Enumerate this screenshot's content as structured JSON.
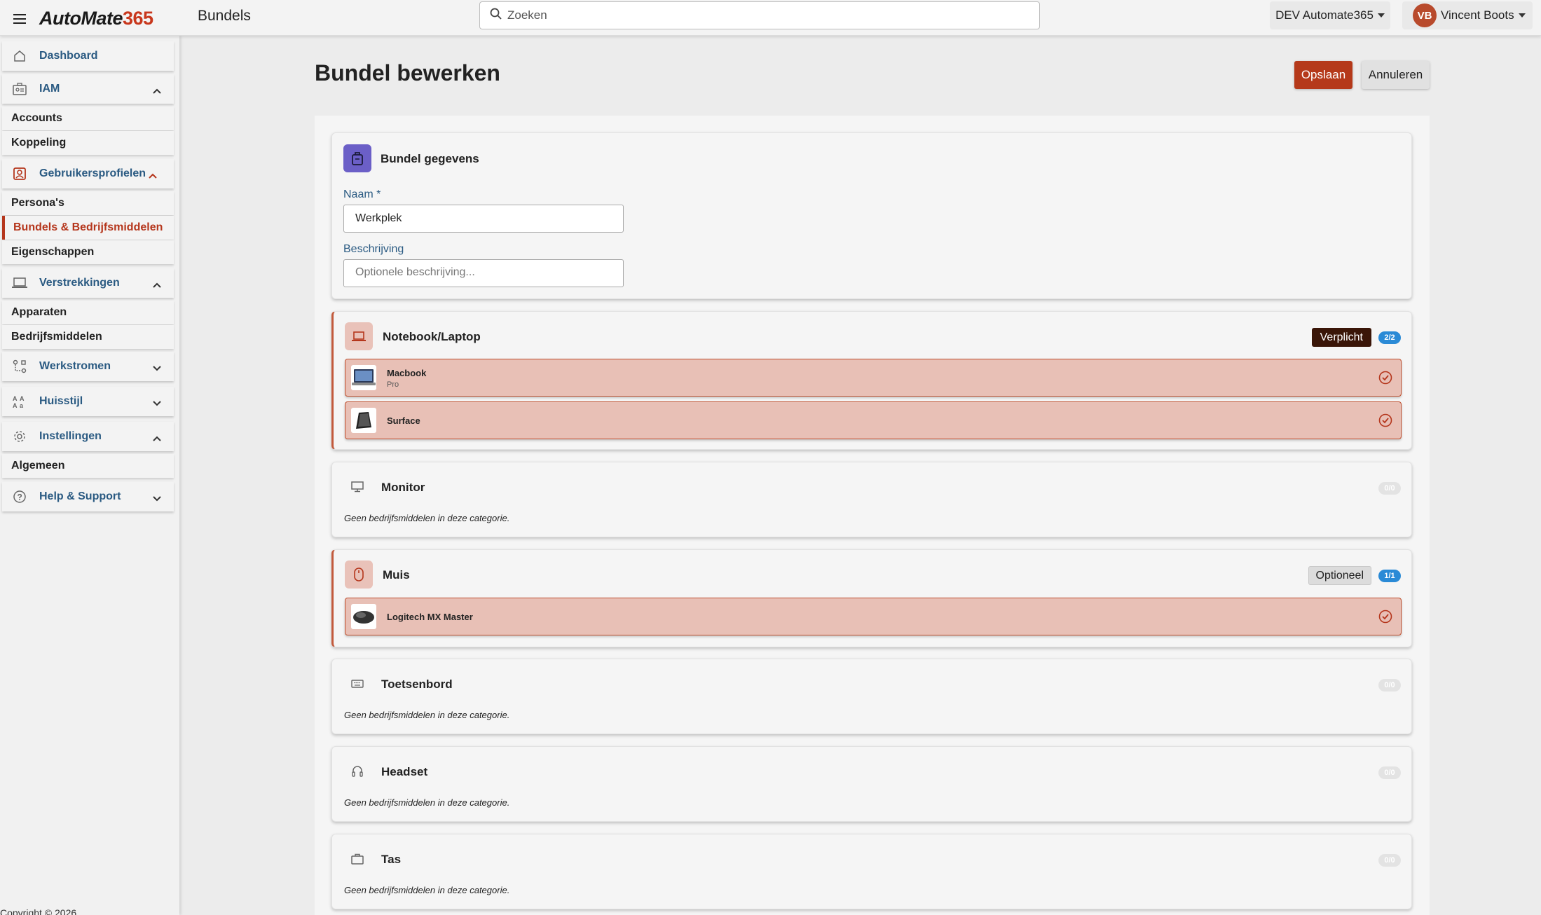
{
  "app": {
    "logo_part1": "AutoMate",
    "logo_part2": "365",
    "page_name": "Bundels"
  },
  "search": {
    "placeholder": "Zoeken"
  },
  "tenant": {
    "label": "DEV Automate365"
  },
  "user": {
    "initials": "VB",
    "name": "Vincent Boots"
  },
  "sidebar": {
    "dashboard": "Dashboard",
    "iam": {
      "label": "IAM",
      "items": [
        "Accounts",
        "Koppeling"
      ]
    },
    "profiles": {
      "label": "Gebruikersprofielen",
      "items": [
        "Persona's",
        "Bundels & Bedrijfsmiddelen",
        "Eigenschappen"
      ]
    },
    "provisioning": {
      "label": "Verstrekkingen",
      "items": [
        "Apparaten",
        "Bedrijfsmiddelen"
      ]
    },
    "workflows": {
      "label": "Werkstromen"
    },
    "branding": {
      "label": "Huisstijl"
    },
    "settings": {
      "label": "Instellingen",
      "items": [
        "Algemeen"
      ]
    },
    "help": {
      "label": "Help & Support"
    },
    "copyright": "Copyright © 2026"
  },
  "page": {
    "title": "Bundel bewerken",
    "save_label": "Opslaan",
    "cancel_label": "Annuleren"
  },
  "details": {
    "title": "Bundel gegevens",
    "name_label": "Naam *",
    "name_value": "Werkplek",
    "description_label": "Beschrijving",
    "description_placeholder": "Optionele beschrijving..."
  },
  "empty_text": "Geen bedrijfsmiddelen in deze categorie.",
  "categories": {
    "laptop": {
      "title": "Notebook/Laptop",
      "badge": "Verplicht",
      "count": "2/2",
      "items": [
        {
          "name": "Macbook",
          "sub": "Pro"
        },
        {
          "name": "Surface"
        }
      ]
    },
    "monitor": {
      "title": "Monitor",
      "count": "0/0"
    },
    "mouse": {
      "title": "Muis",
      "badge": "Optioneel",
      "count": "1/1",
      "items": [
        {
          "name": "Logitech MX Master"
        }
      ]
    },
    "keyboard": {
      "title": "Toetsenbord",
      "count": "0/0"
    },
    "headset": {
      "title": "Headset",
      "count": "0/0"
    },
    "bag": {
      "title": "Tas",
      "count": "0/0"
    }
  },
  "colors": {
    "accent": "#b5391a",
    "item_bg": "#e8c0b6",
    "badge_blue": "#2a8ad6",
    "required_bg": "#3a1608"
  }
}
